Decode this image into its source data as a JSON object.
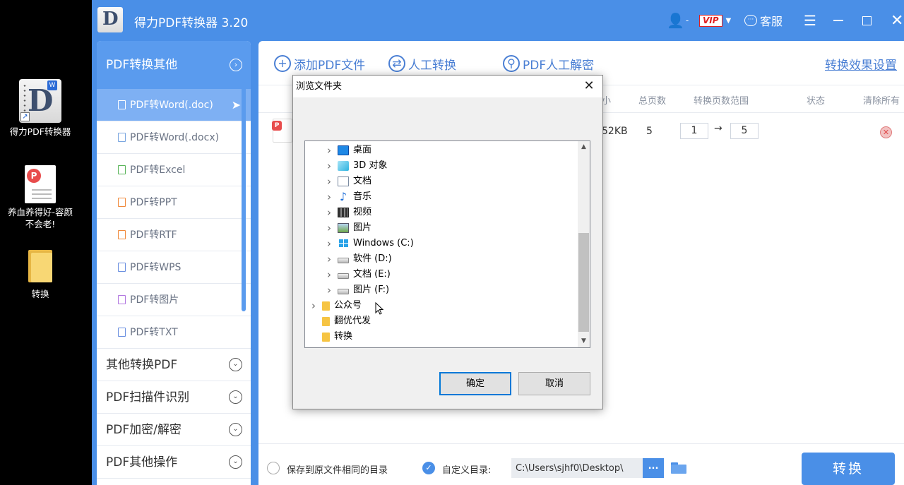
{
  "desktop": {
    "icons": [
      {
        "label": "得力PDF转换器",
        "icon": "app-icon"
      },
      {
        "label": "养血养得好-容颜不会老!",
        "icon": "pdf-file-icon"
      },
      {
        "label": "转换",
        "icon": "folder-icon"
      }
    ]
  },
  "app": {
    "title": "得力PDF转换器 3.20",
    "vip_label": "VIP",
    "service_label": "客服",
    "accent": "#4a8fe7"
  },
  "sidebar": {
    "header": "PDF转换其他",
    "items": [
      {
        "label": "PDF转Word(.doc)",
        "active": true
      },
      {
        "label": "PDF转Word(.docx)"
      },
      {
        "label": "PDF转Excel"
      },
      {
        "label": "PDF转PPT"
      },
      {
        "label": "PDF转RTF"
      },
      {
        "label": "PDF转WPS"
      },
      {
        "label": "PDF转图片"
      },
      {
        "label": "PDF转TXT"
      }
    ],
    "groups": [
      {
        "label": "其他转换PDF"
      },
      {
        "label": "PDF扫描件识别"
      },
      {
        "label": "PDF加密/解密"
      },
      {
        "label": "PDF其他操作"
      }
    ]
  },
  "toolbar": {
    "add_label": "添加PDF文件",
    "manual_label": "人工转换",
    "decrypt_label": "PDF人工解密",
    "settings_label": "转换效果设置"
  },
  "table": {
    "headers": {
      "size_partial": "小",
      "pages": "总页数",
      "range": "转换页数范围",
      "status": "状态",
      "clear": "清除所有"
    },
    "row": {
      "size_partial": "52KB",
      "pages": "5",
      "range_from": "1",
      "range_to": "5"
    }
  },
  "footer": {
    "same_dir_label": "保存到原文件相同的目录",
    "custom_dir_label": "自定义目录:",
    "path_value": "C:\\Users\\sjhf0\\Desktop\\",
    "browse_label": "...",
    "convert_label": "转换"
  },
  "dialog": {
    "title": "浏览文件夹",
    "tree": [
      {
        "label": "桌面",
        "icon": "desktop-icon",
        "expandable": true
      },
      {
        "label": "3D 对象",
        "icon": "3d-objects-icon",
        "expandable": true
      },
      {
        "label": "文档",
        "icon": "documents-icon",
        "expandable": true
      },
      {
        "label": "音乐",
        "icon": "music-icon",
        "expandable": true
      },
      {
        "label": "视频",
        "icon": "video-icon",
        "expandable": true
      },
      {
        "label": "图片",
        "icon": "pictures-icon",
        "expandable": true
      },
      {
        "label": "Windows (C:)",
        "icon": "windows-drive-icon",
        "expandable": true
      },
      {
        "label": "软件 (D:)",
        "icon": "drive-icon",
        "expandable": true
      },
      {
        "label": "文档 (E:)",
        "icon": "drive-icon",
        "expandable": true
      },
      {
        "label": "图片 (F:)",
        "icon": "drive-icon",
        "expandable": true
      },
      {
        "label": "公众号",
        "icon": "folder-icon",
        "expandable": true
      },
      {
        "label": "翻优代发",
        "icon": "folder-icon",
        "expandable": false
      },
      {
        "label": "转换",
        "icon": "folder-icon",
        "expandable": false
      }
    ],
    "ok_label": "确定",
    "cancel_label": "取消"
  }
}
